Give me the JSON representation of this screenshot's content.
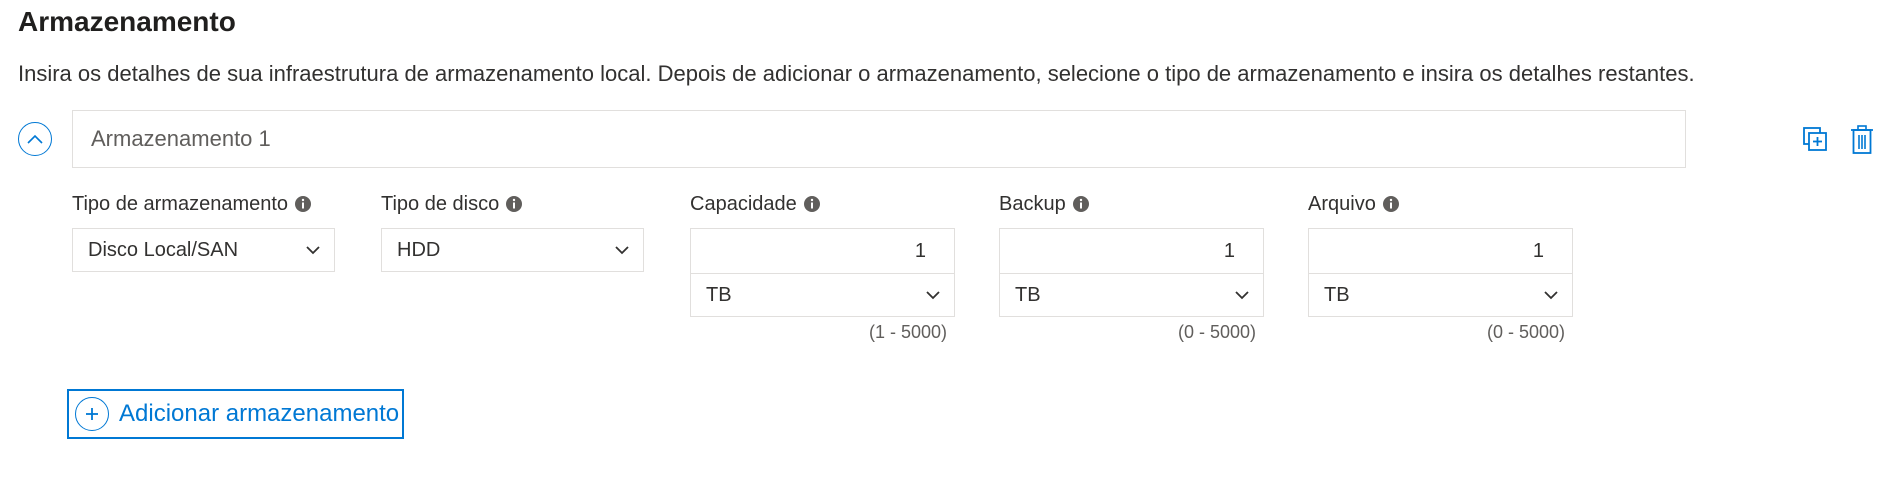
{
  "header": {
    "title": "Armazenamento",
    "description": "Insira os detalhes de sua infraestrutura de armazenamento local. Depois de adicionar o armazenamento, selecione o tipo de armazenamento e insira os detalhes restantes."
  },
  "storage_item": {
    "name_placeholder": "Armazenamento 1",
    "fields": {
      "storage_type": {
        "label": "Tipo de armazenamento",
        "value": "Disco Local/SAN"
      },
      "disk_type": {
        "label": "Tipo de disco",
        "value": "HDD"
      },
      "capacity": {
        "label": "Capacidade",
        "value": "1",
        "unit": "TB",
        "range": "(1 - 5000)"
      },
      "backup": {
        "label": "Backup",
        "value": "1",
        "unit": "TB",
        "range": "(0 - 5000)"
      },
      "archive": {
        "label": "Arquivo",
        "value": "1",
        "unit": "TB",
        "range": "(0 - 5000)"
      }
    },
    "icons": {
      "collapse": "chevron-up-icon",
      "duplicate": "copy-icon",
      "delete": "trash-icon",
      "info": "info-icon"
    }
  },
  "actions": {
    "add_storage_label": "Adicionar armazenamento"
  },
  "colors": {
    "accent": "#0078d4",
    "border": "#e1dfdd",
    "text": "#323130",
    "muted": "#605e5c"
  }
}
